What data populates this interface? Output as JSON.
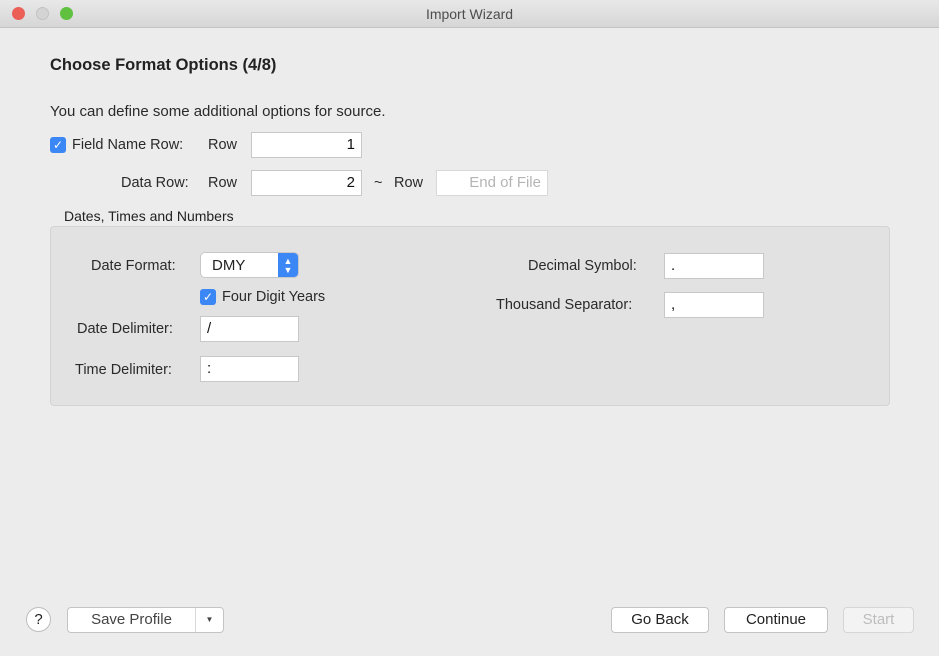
{
  "window": {
    "title": "Import Wizard"
  },
  "heading": "Choose Format Options (4/8)",
  "description": "You can define some additional options for source.",
  "field_name_row": {
    "label": "Field Name Row:",
    "checked": true,
    "row_label": "Row",
    "value": "1"
  },
  "data_row": {
    "label": "Data Row:",
    "row_label": "Row",
    "value": "2",
    "tilde": "~",
    "end_row_label": "Row",
    "end_placeholder": "End of File"
  },
  "group": {
    "title": "Dates, Times and Numbers",
    "date_format": {
      "label": "Date Format:",
      "value": "DMY"
    },
    "four_digit_years": {
      "label": "Four Digit Years",
      "checked": true
    },
    "date_delimiter": {
      "label": "Date Delimiter:",
      "value": "/"
    },
    "time_delimiter": {
      "label": "Time Delimiter:",
      "value": ":"
    },
    "decimal_symbol": {
      "label": "Decimal Symbol:",
      "value": "."
    },
    "thousand_separator": {
      "label": "Thousand Separator:",
      "value": ","
    }
  },
  "footer": {
    "help": "?",
    "save_profile": "Save Profile",
    "go_back": "Go Back",
    "continue": "Continue",
    "start": "Start"
  },
  "colors": {
    "accent": "#3b87f5"
  }
}
